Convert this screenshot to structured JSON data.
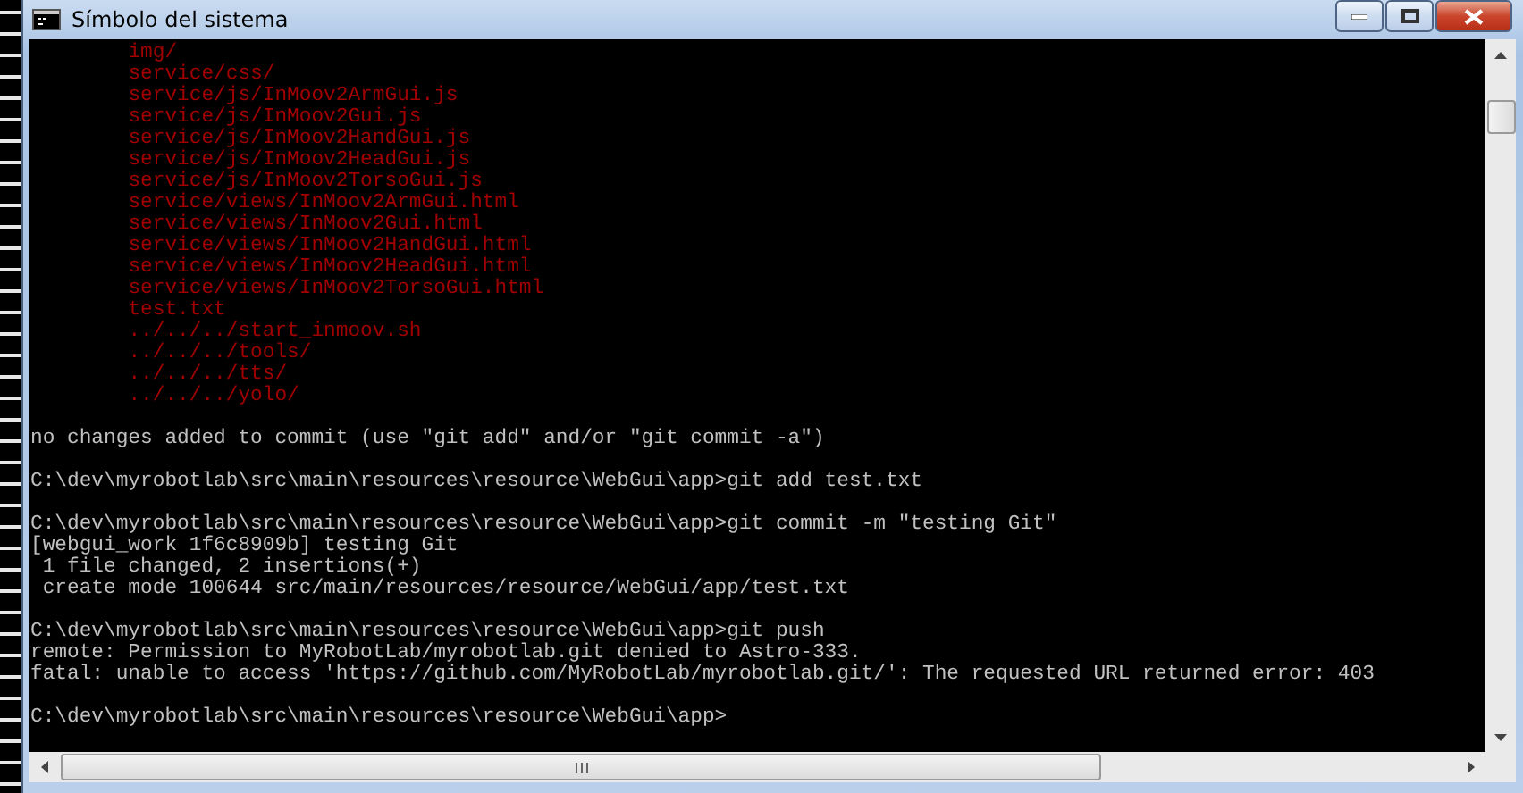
{
  "window": {
    "title": "Símbolo del sistema"
  },
  "console": {
    "lines": [
      {
        "kind": "untracked",
        "text": "img/"
      },
      {
        "kind": "untracked",
        "text": "service/css/"
      },
      {
        "kind": "untracked",
        "text": "service/js/InMoov2ArmGui.js"
      },
      {
        "kind": "untracked",
        "text": "service/js/InMoov2Gui.js"
      },
      {
        "kind": "untracked",
        "text": "service/js/InMoov2HandGui.js"
      },
      {
        "kind": "untracked",
        "text": "service/js/InMoov2HeadGui.js"
      },
      {
        "kind": "untracked",
        "text": "service/js/InMoov2TorsoGui.js"
      },
      {
        "kind": "untracked",
        "text": "service/views/InMoov2ArmGui.html"
      },
      {
        "kind": "untracked",
        "text": "service/views/InMoov2Gui.html"
      },
      {
        "kind": "untracked",
        "text": "service/views/InMoov2HandGui.html"
      },
      {
        "kind": "untracked",
        "text": "service/views/InMoov2HeadGui.html"
      },
      {
        "kind": "untracked",
        "text": "service/views/InMoov2TorsoGui.html"
      },
      {
        "kind": "untracked",
        "text": "test.txt"
      },
      {
        "kind": "untracked",
        "text": "../../../start_inmoov.sh"
      },
      {
        "kind": "untracked",
        "text": "../../../tools/"
      },
      {
        "kind": "untracked",
        "text": "../../../tts/"
      },
      {
        "kind": "untracked",
        "text": "../../../yolo/"
      },
      {
        "kind": "blank"
      },
      {
        "kind": "output",
        "text": "no changes added to commit (use \"git add\" and/or \"git commit -a\")"
      },
      {
        "kind": "blank"
      },
      {
        "kind": "output",
        "text": "C:\\dev\\myrobotlab\\src\\main\\resources\\resource\\WebGui\\app>git add test.txt"
      },
      {
        "kind": "blank"
      },
      {
        "kind": "output",
        "text": "C:\\dev\\myrobotlab\\src\\main\\resources\\resource\\WebGui\\app>git commit -m \"testing Git\""
      },
      {
        "kind": "output",
        "text": "[webgui_work 1f6c8909b] testing Git"
      },
      {
        "kind": "output",
        "text": " 1 file changed, 2 insertions(+)"
      },
      {
        "kind": "output",
        "text": " create mode 100644 src/main/resources/resource/WebGui/app/test.txt"
      },
      {
        "kind": "blank"
      },
      {
        "kind": "output",
        "text": "C:\\dev\\myrobotlab\\src\\main\\resources\\resource\\WebGui\\app>git push"
      },
      {
        "kind": "output",
        "text": "remote: Permission to MyRobotLab/myrobotlab.git denied to Astro-333."
      },
      {
        "kind": "output",
        "text": "fatal: unable to access 'https://github.com/MyRobotLab/myrobotlab.git/': The requested URL returned error: 403"
      },
      {
        "kind": "blank"
      },
      {
        "kind": "output",
        "text": "C:\\dev\\myrobotlab\\src\\main\\resources\\resource\\WebGui\\app>"
      }
    ]
  }
}
